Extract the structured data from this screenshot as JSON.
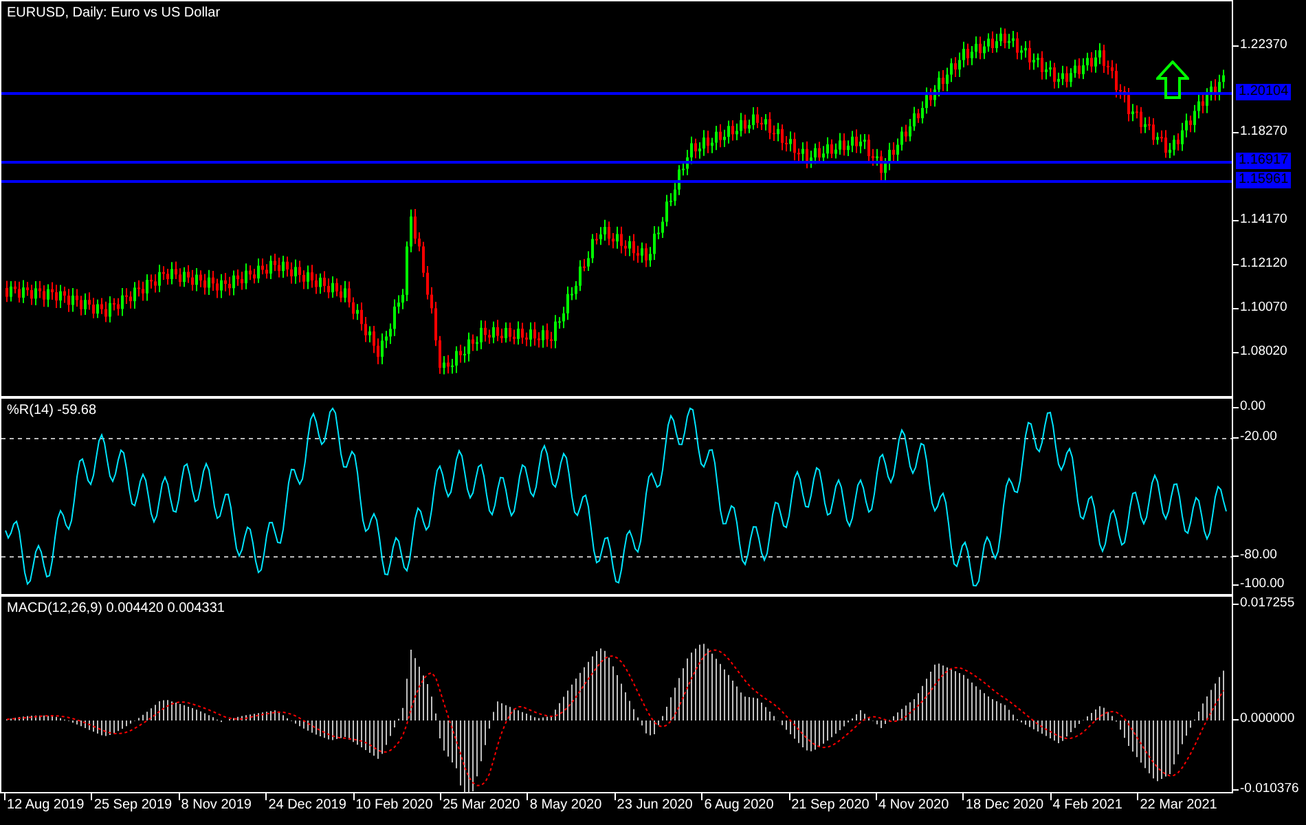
{
  "title": "EURUSD, Daily:  Euro vs US Dollar",
  "price_axis": [
    "1.22370",
    "1.18270",
    "1.14170",
    "1.12120",
    "1.10070",
    "1.08020"
  ],
  "levels": [
    {
      "price": "1.20104"
    },
    {
      "price": "1.16917"
    },
    {
      "price": "1.15961"
    }
  ],
  "wpr": {
    "title": "%R(14) -59.68",
    "labels": [
      "0.00",
      "-20.00",
      "-80.00",
      "-100.00"
    ]
  },
  "macd": {
    "title": "MACD(12,26,9) 0.004420 0.004331",
    "labels": [
      "0.017255",
      "0.000000",
      "-0.010376"
    ]
  },
  "time_axis": [
    "12 Aug 2019",
    "25 Sep 2019",
    "8 Nov 2019",
    "24 Dec 2019",
    "10 Feb 2020",
    "25 Mar 2020",
    "8 May 2020",
    "23 Jun 2020",
    "6 Aug 2020",
    "21 Sep 2020",
    "4 Nov 2020",
    "18 Dec 2020",
    "4 Feb 2021",
    "22 Mar 2021"
  ]
}
